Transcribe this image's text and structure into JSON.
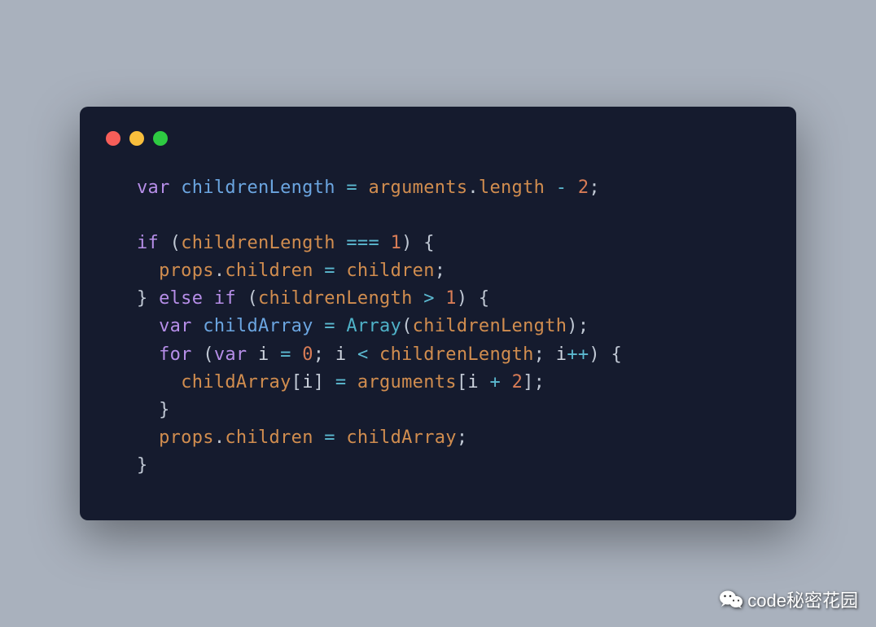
{
  "code": {
    "tokens": [
      [
        {
          "t": "var ",
          "c": "kw"
        },
        {
          "t": "childrenLength",
          "c": "var1"
        },
        {
          "t": " ",
          "c": "plain"
        },
        {
          "t": "=",
          "c": "op"
        },
        {
          "t": " ",
          "c": "plain"
        },
        {
          "t": "arguments",
          "c": "var2"
        },
        {
          "t": ".",
          "c": "punct"
        },
        {
          "t": "length",
          "c": "prop"
        },
        {
          "t": " ",
          "c": "plain"
        },
        {
          "t": "-",
          "c": "op"
        },
        {
          "t": " ",
          "c": "plain"
        },
        {
          "t": "2",
          "c": "num"
        },
        {
          "t": ";",
          "c": "punct"
        }
      ],
      [],
      [
        {
          "t": "if",
          "c": "kw"
        },
        {
          "t": " (",
          "c": "punct"
        },
        {
          "t": "childrenLength",
          "c": "var2"
        },
        {
          "t": " ",
          "c": "plain"
        },
        {
          "t": "===",
          "c": "op"
        },
        {
          "t": " ",
          "c": "plain"
        },
        {
          "t": "1",
          "c": "num"
        },
        {
          "t": ") {",
          "c": "punct"
        }
      ],
      [
        {
          "t": "  ",
          "c": "plain"
        },
        {
          "t": "props",
          "c": "var2"
        },
        {
          "t": ".",
          "c": "punct"
        },
        {
          "t": "children",
          "c": "prop"
        },
        {
          "t": " ",
          "c": "plain"
        },
        {
          "t": "=",
          "c": "op"
        },
        {
          "t": " ",
          "c": "plain"
        },
        {
          "t": "children",
          "c": "var2"
        },
        {
          "t": ";",
          "c": "punct"
        }
      ],
      [
        {
          "t": "} ",
          "c": "punct"
        },
        {
          "t": "else if",
          "c": "kw"
        },
        {
          "t": " (",
          "c": "punct"
        },
        {
          "t": "childrenLength",
          "c": "var2"
        },
        {
          "t": " ",
          "c": "plain"
        },
        {
          "t": ">",
          "c": "op"
        },
        {
          "t": " ",
          "c": "plain"
        },
        {
          "t": "1",
          "c": "num"
        },
        {
          "t": ") {",
          "c": "punct"
        }
      ],
      [
        {
          "t": "  ",
          "c": "plain"
        },
        {
          "t": "var ",
          "c": "kw"
        },
        {
          "t": "childArray",
          "c": "var1"
        },
        {
          "t": " ",
          "c": "plain"
        },
        {
          "t": "=",
          "c": "op"
        },
        {
          "t": " ",
          "c": "plain"
        },
        {
          "t": "Array",
          "c": "fn"
        },
        {
          "t": "(",
          "c": "punct"
        },
        {
          "t": "childrenLength",
          "c": "var2"
        },
        {
          "t": ");",
          "c": "punct"
        }
      ],
      [
        {
          "t": "  ",
          "c": "plain"
        },
        {
          "t": "for",
          "c": "kw"
        },
        {
          "t": " (",
          "c": "punct"
        },
        {
          "t": "var ",
          "c": "kw"
        },
        {
          "t": "i",
          "c": "ident"
        },
        {
          "t": " ",
          "c": "plain"
        },
        {
          "t": "=",
          "c": "op"
        },
        {
          "t": " ",
          "c": "plain"
        },
        {
          "t": "0",
          "c": "num"
        },
        {
          "t": "; ",
          "c": "punct"
        },
        {
          "t": "i",
          "c": "ident"
        },
        {
          "t": " ",
          "c": "plain"
        },
        {
          "t": "<",
          "c": "op"
        },
        {
          "t": " ",
          "c": "plain"
        },
        {
          "t": "childrenLength",
          "c": "var2"
        },
        {
          "t": "; ",
          "c": "punct"
        },
        {
          "t": "i",
          "c": "ident"
        },
        {
          "t": "++",
          "c": "op"
        },
        {
          "t": ") {",
          "c": "punct"
        }
      ],
      [
        {
          "t": "    ",
          "c": "plain"
        },
        {
          "t": "childArray",
          "c": "var2"
        },
        {
          "t": "[",
          "c": "punct"
        },
        {
          "t": "i",
          "c": "ident"
        },
        {
          "t": "] ",
          "c": "punct"
        },
        {
          "t": "=",
          "c": "op"
        },
        {
          "t": " ",
          "c": "plain"
        },
        {
          "t": "arguments",
          "c": "var2"
        },
        {
          "t": "[",
          "c": "punct"
        },
        {
          "t": "i",
          "c": "ident"
        },
        {
          "t": " ",
          "c": "plain"
        },
        {
          "t": "+",
          "c": "op"
        },
        {
          "t": " ",
          "c": "plain"
        },
        {
          "t": "2",
          "c": "num"
        },
        {
          "t": "];",
          "c": "punct"
        }
      ],
      [
        {
          "t": "  }",
          "c": "punct"
        }
      ],
      [
        {
          "t": "  ",
          "c": "plain"
        },
        {
          "t": "props",
          "c": "var2"
        },
        {
          "t": ".",
          "c": "punct"
        },
        {
          "t": "children",
          "c": "prop"
        },
        {
          "t": " ",
          "c": "plain"
        },
        {
          "t": "=",
          "c": "op"
        },
        {
          "t": " ",
          "c": "plain"
        },
        {
          "t": "childArray",
          "c": "var2"
        },
        {
          "t": ";",
          "c": "punct"
        }
      ],
      [
        {
          "t": "}",
          "c": "punct"
        }
      ]
    ]
  },
  "watermark": {
    "text": "code秘密花园"
  }
}
